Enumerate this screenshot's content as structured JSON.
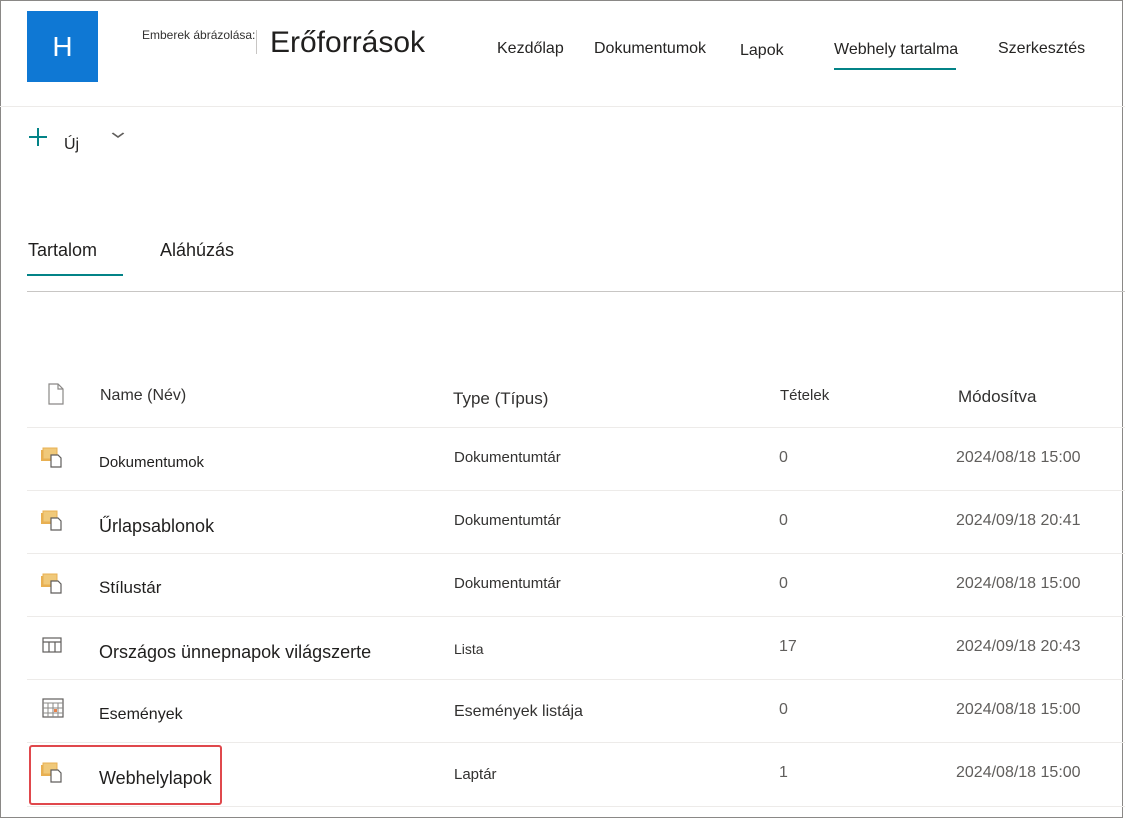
{
  "header": {
    "logo_letter": "H",
    "subtitle": "Emberek ábrázolása:",
    "site_title": "Erőforrások",
    "nav": [
      {
        "label": "Kezdőlap"
      },
      {
        "label": "Dokumentumok"
      },
      {
        "label": "Lapok"
      },
      {
        "label": "Webhely tartalma",
        "active": true
      },
      {
        "label": "Szerkesztés"
      }
    ]
  },
  "command_bar": {
    "new_label": "Új",
    "chevron": "⌄"
  },
  "tabs": [
    {
      "label": "Tartalom",
      "active": true
    },
    {
      "label": "Aláhúzás"
    }
  ],
  "table": {
    "headers": {
      "name": "Name (Név)",
      "type": "Type (Típus)",
      "items": "Tételek",
      "modified": "Módosítva"
    },
    "rows": [
      {
        "name": "Dokumentumok",
        "type": "Dokumentumtár",
        "items": "0",
        "modified": "2024/08/18 15:00",
        "icon": "document-library-icon"
      },
      {
        "name": "Űrlapsablonok",
        "type": "Dokumentumtár",
        "items": "0",
        "modified": "2024/09/18 20:41",
        "icon": "document-library-icon"
      },
      {
        "name": "Stílustár",
        "type": "Dokumentumtár",
        "items": "0",
        "modified": "2024/08/18 15:00",
        "icon": "document-library-icon"
      },
      {
        "name": "Országos ünnepnapok világszerte",
        "type": "Lista",
        "items": "17",
        "modified": "2024/09/18 20:43",
        "icon": "list-icon"
      },
      {
        "name": "Események",
        "type": "Események listája",
        "items": "0",
        "modified": "2024/08/18 15:00",
        "icon": "calendar-icon"
      },
      {
        "name": "Webhelylapok",
        "type": "Laptár",
        "items": "1",
        "modified": "2024/08/18 15:00",
        "icon": "document-library-icon",
        "highlighted": true
      }
    ]
  },
  "colors": {
    "accent": "#038387",
    "logo_bg": "#0f78d4",
    "highlight": "#e0484c",
    "library_icon": "#e8b052"
  }
}
